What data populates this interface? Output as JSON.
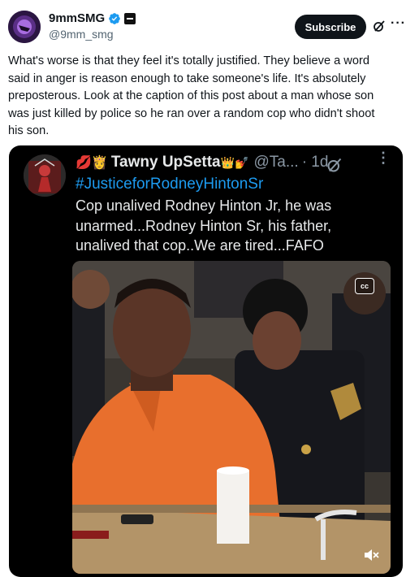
{
  "post": {
    "author": {
      "display_name": "9mmSMG",
      "handle": "@9mm_smg"
    },
    "subscribe_label": "Subscribe",
    "more_label": "···",
    "text_lines": [
      "What's worse is that they feel it's totally justified. They believe a word",
      "said in anger is reason enough to take someone's life. It's absolutely",
      "preposterous. Look at the caption of this post about a man whose son",
      "was just killed by police so he ran over a random cop who didn't shoot",
      "his son."
    ]
  },
  "embedded_video": {
    "author": {
      "display_name": "Tawny UpSetta",
      "name_prefix_emoji": "💋👸",
      "name_suffix_emoji": "👑💅",
      "handle": "@Ta...",
      "time": "· 1d"
    },
    "hashtag": "#JusticeforRodneyHintonSr",
    "caption_lines": [
      "Cop unalived Rodney Hinton Jr, he was",
      "unarmed...Rodney Hinton Sr, his father,",
      "unalived that cop..We are tired...FAFO"
    ],
    "cc_label": "cc",
    "more_label": "⋮"
  },
  "colors": {
    "link_blue": "#1d9bf0",
    "verified_blue": "#1d9bf0",
    "subscribe_bg": "#0f1419",
    "inmate_orange": "#e86f2d"
  },
  "icons": [
    "verified-badge-icon",
    "affiliate-badge-icon",
    "grok-icon",
    "more-icon",
    "closed-captions-icon",
    "volume-muted-icon"
  ]
}
